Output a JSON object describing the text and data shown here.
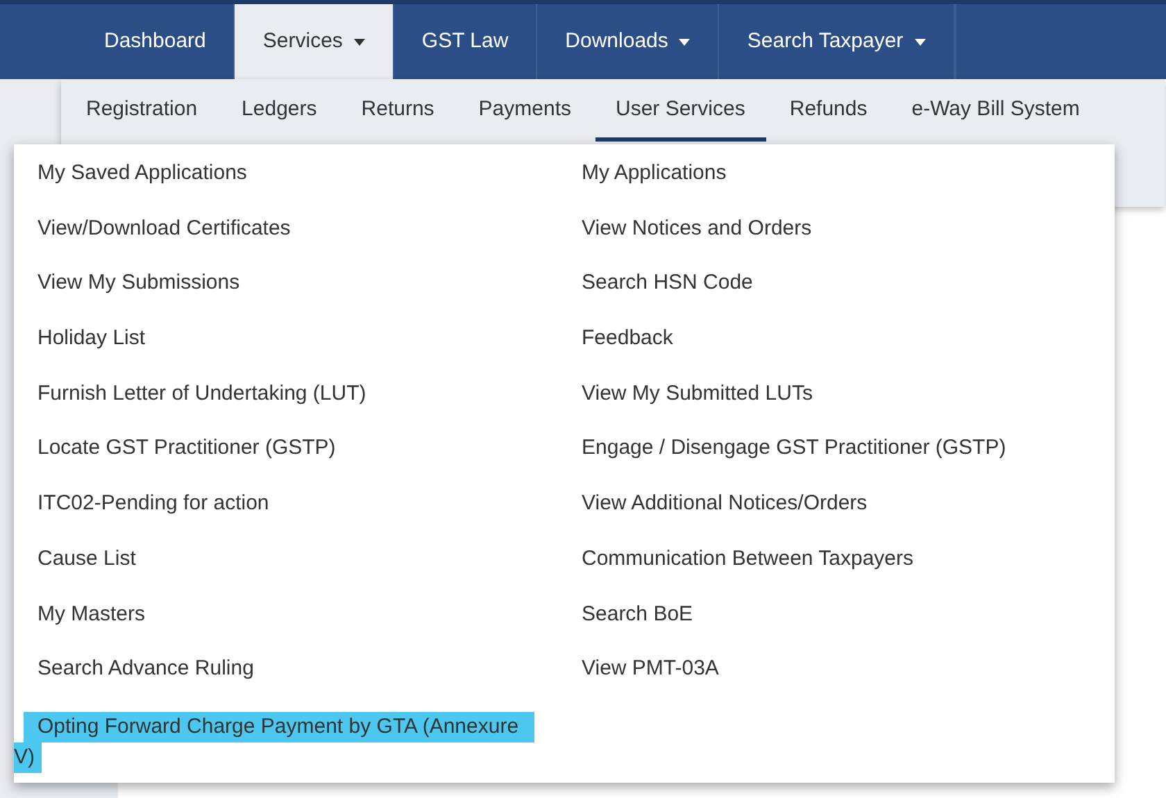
{
  "main_nav": [
    {
      "label": "Dashboard",
      "selected": false,
      "dropdown": false
    },
    {
      "label": "Services",
      "selected": true,
      "dropdown": true
    },
    {
      "label": "GST Law",
      "selected": false,
      "dropdown": false
    },
    {
      "label": "Downloads",
      "selected": false,
      "dropdown": true
    },
    {
      "label": "Search Taxpayer",
      "selected": false,
      "dropdown": true
    }
  ],
  "sub_nav": [
    {
      "label": "Registration",
      "selected": false
    },
    {
      "label": "Ledgers",
      "selected": false
    },
    {
      "label": "Returns",
      "selected": false
    },
    {
      "label": "Payments",
      "selected": false
    },
    {
      "label": "User Services",
      "selected": true
    },
    {
      "label": "Refunds",
      "selected": false
    },
    {
      "label": "e-Way Bill System",
      "selected": false
    }
  ],
  "menu_columns": [
    [
      {
        "label": "My Saved Applications",
        "highlighted": false
      },
      {
        "label": "View/Download Certificates",
        "highlighted": false
      },
      {
        "label": "View My Submissions",
        "highlighted": false
      },
      {
        "label": "Holiday List",
        "highlighted": false
      },
      {
        "label": "Furnish Letter of Undertaking (LUT)",
        "highlighted": false
      },
      {
        "label": "Locate GST Practitioner (GSTP)",
        "highlighted": false
      },
      {
        "label": "ITC02-Pending for action",
        "highlighted": false
      },
      {
        "label": "Cause List",
        "highlighted": false
      },
      {
        "label": "My Masters",
        "highlighted": false
      },
      {
        "label": "Search Advance Ruling",
        "highlighted": false
      },
      {
        "label": "Opting Forward Charge Payment by GTA (Annexure V)",
        "highlighted": true
      }
    ],
    [
      {
        "label": "My Applications",
        "highlighted": false
      },
      {
        "label": "View Notices and Orders",
        "highlighted": false
      },
      {
        "label": "Search HSN Code",
        "highlighted": false
      },
      {
        "label": "Feedback",
        "highlighted": false
      },
      {
        "label": "View My Submitted LUTs",
        "highlighted": false
      },
      {
        "label": "Engage / Disengage GST Practitioner (GSTP)",
        "highlighted": false
      },
      {
        "label": "View Additional Notices/Orders",
        "highlighted": false
      },
      {
        "label": "Communication Between Taxpayers",
        "highlighted": false
      },
      {
        "label": "Search BoE",
        "highlighted": false
      },
      {
        "label": "View PMT-03A",
        "highlighted": false
      }
    ]
  ]
}
